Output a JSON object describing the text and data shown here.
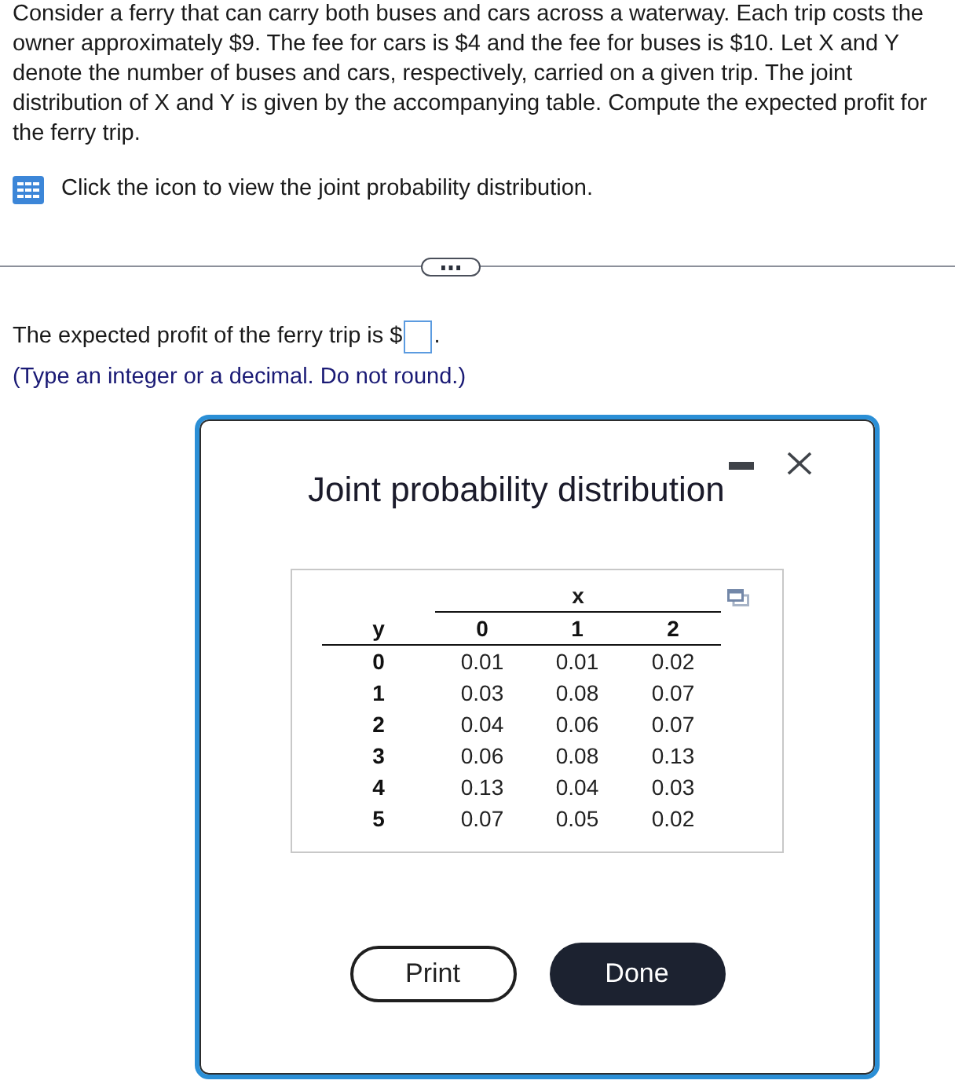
{
  "problem": {
    "text": "Consider a ferry that can carry both buses and cars across a waterway. Each trip costs the owner approximately $9. The fee for cars is $4 and the fee for buses is $10. Let X and Y denote the number of buses and cars, respectively, carried on a given trip. The joint distribution of X and Y is given by the accompanying table. Compute the expected profit for the ferry trip."
  },
  "table_link": {
    "text": "Click the icon to view the joint probability distribution."
  },
  "answer": {
    "prompt": "The expected profit of the ferry trip is $",
    "after": ".",
    "hint": "(Type an integer or a decimal. Do not round.)"
  },
  "dialog": {
    "title": "Joint probability distribution",
    "table": {
      "column_variable": "x",
      "row_variable": "y",
      "columns": [
        "0",
        "1",
        "2"
      ],
      "rows": [
        {
          "label": "0",
          "cells": [
            "0.01",
            "0.01",
            "0.02"
          ]
        },
        {
          "label": "1",
          "cells": [
            "0.03",
            "0.08",
            "0.07"
          ]
        },
        {
          "label": "2",
          "cells": [
            "0.04",
            "0.06",
            "0.07"
          ]
        },
        {
          "label": "3",
          "cells": [
            "0.06",
            "0.08",
            "0.13"
          ]
        },
        {
          "label": "4",
          "cells": [
            "0.13",
            "0.04",
            "0.03"
          ]
        },
        {
          "label": "5",
          "cells": [
            "0.07",
            "0.05",
            "0.02"
          ]
        }
      ]
    },
    "buttons": [
      {
        "label": "Print",
        "kind": "outline"
      },
      {
        "label": "Done",
        "kind": "filled"
      }
    ]
  }
}
